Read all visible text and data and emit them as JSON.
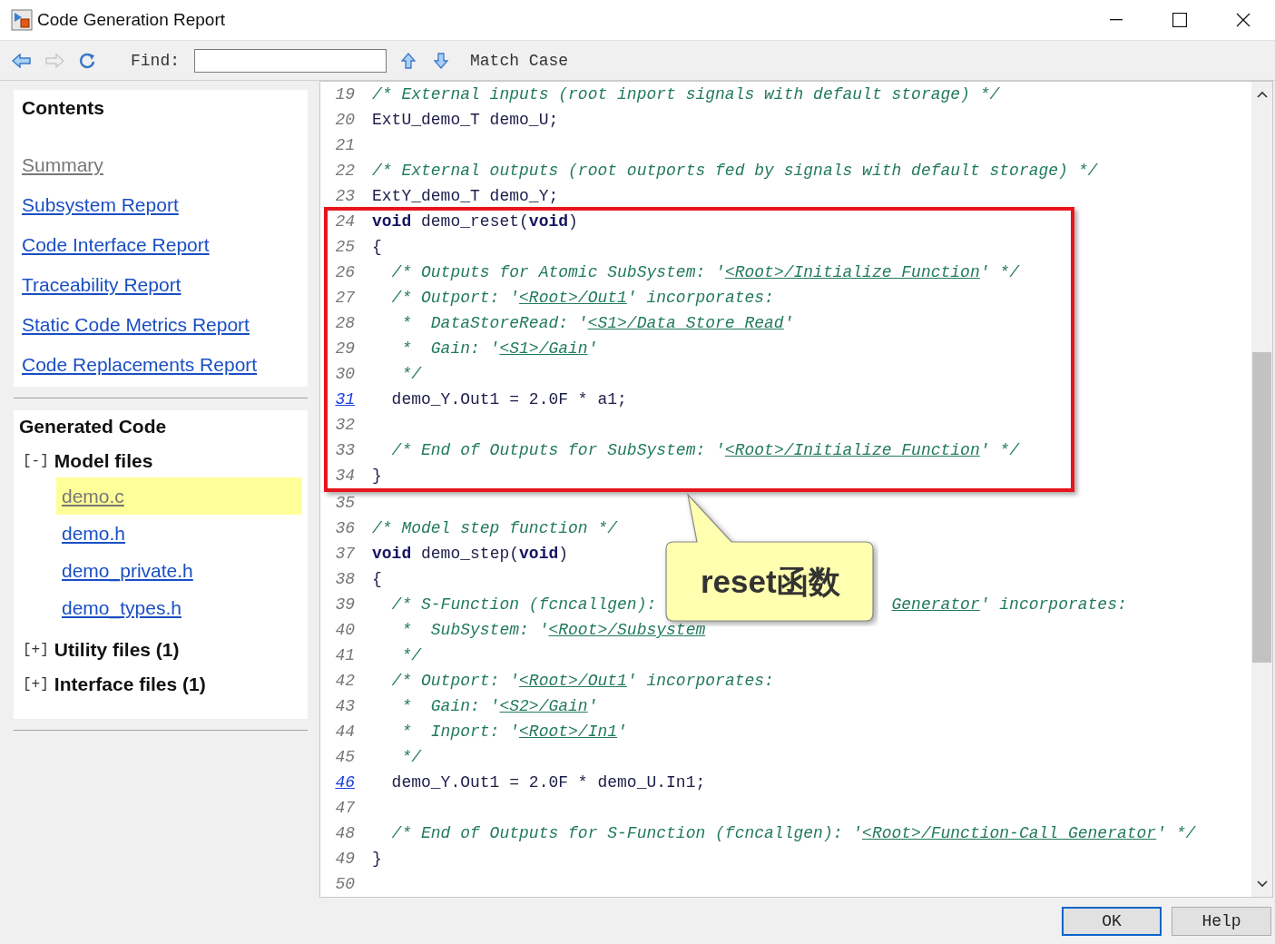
{
  "window": {
    "title": "Code Generation Report"
  },
  "toolbar": {
    "nav_buttons": [
      {
        "kind": "back",
        "disabled": false
      },
      {
        "kind": "forward",
        "disabled": true
      },
      {
        "kind": "refresh",
        "disabled": false
      }
    ],
    "find_label": "Find:",
    "match_case": "Match Case"
  },
  "sidebar": {
    "contents": {
      "title": "Contents",
      "items": [
        {
          "label": "Summary",
          "visited": true
        },
        {
          "label": "Subsystem Report",
          "visited": false
        },
        {
          "label": "Code Interface Report",
          "visited": false
        },
        {
          "label": "Traceability Report",
          "visited": false
        },
        {
          "label": "Static Code Metrics Report",
          "visited": false
        },
        {
          "label": "Code Replacements Report",
          "visited": false
        }
      ]
    },
    "generated_code": {
      "title": "Generated Code",
      "groups": [
        {
          "toggle": "[-]",
          "label": "Model files",
          "children": [
            {
              "label": "demo.c",
              "selected": true
            },
            {
              "label": "demo.h",
              "selected": false
            },
            {
              "label": "demo_private.h",
              "selected": false
            },
            {
              "label": "demo_types.h",
              "selected": false
            }
          ]
        },
        {
          "toggle": "[+]",
          "label": "Utility files (1)"
        },
        {
          "toggle": "[+]",
          "label": "Interface files (1)"
        }
      ]
    }
  },
  "code": {
    "sections": [
      {
        "highlighted": false,
        "lines": [
          {
            "number": "19",
            "number_link": false,
            "segments": [
              {
                "kind": "comment",
                "text": "/* External inputs (root inport signals with default storage) */"
              }
            ]
          },
          {
            "number": "20",
            "number_link": false,
            "segments": [
              {
                "kind": "code",
                "text": "ExtU_demo_T demo_U;"
              }
            ]
          },
          {
            "number": "21",
            "number_link": false
          },
          {
            "number": "22",
            "number_link": false,
            "segments": [
              {
                "kind": "comment",
                "text": "/* External outputs (root outports fed by signals with default storage) */"
              }
            ]
          },
          {
            "number": "23",
            "number_link": false,
            "segments": [
              {
                "kind": "code",
                "text": "ExtY_demo_T demo_Y;"
              }
            ]
          }
        ]
      },
      {
        "highlighted": true,
        "lines": [
          {
            "number": "24",
            "number_link": false,
            "segments": [
              {
                "kind": "keyword",
                "text": "void"
              },
              {
                "kind": "code",
                "text": " demo_reset("
              },
              {
                "kind": "keyword",
                "text": "void"
              },
              {
                "kind": "code",
                "text": ")"
              }
            ]
          },
          {
            "number": "25",
            "number_link": false,
            "segments": [
              {
                "kind": "code",
                "text": "{"
              }
            ]
          },
          {
            "number": "26",
            "number_link": false,
            "segments": [
              {
                "kind": "comment",
                "text": "  /* Outputs for Atomic SubSystem: '"
              },
              {
                "kind": "link",
                "text": "<Root>/Initialize Function"
              },
              {
                "kind": "comment",
                "text": "' */"
              }
            ]
          },
          {
            "number": "27",
            "number_link": false,
            "segments": [
              {
                "kind": "comment",
                "text": "  /* Outport: '"
              },
              {
                "kind": "link",
                "text": "<Root>/Out1"
              },
              {
                "kind": "comment",
                "text": "' incorporates:"
              }
            ]
          },
          {
            "number": "28",
            "number_link": false,
            "segments": [
              {
                "kind": "comment",
                "text": "   *  DataStoreRead: '"
              },
              {
                "kind": "link",
                "text": "<S1>/Data Store Read"
              },
              {
                "kind": "comment",
                "text": "'"
              }
            ]
          },
          {
            "number": "29",
            "number_link": false,
            "segments": [
              {
                "kind": "comment",
                "text": "   *  Gain: '"
              },
              {
                "kind": "link",
                "text": "<S1>/Gain"
              },
              {
                "kind": "comment",
                "text": "'"
              }
            ]
          },
          {
            "number": "30",
            "number_link": false,
            "segments": [
              {
                "kind": "comment",
                "text": "   */"
              }
            ]
          },
          {
            "number": "31",
            "number_link": true,
            "segments": [
              {
                "kind": "code",
                "text": "  demo_Y.Out1 = 2.0F * a1;"
              }
            ]
          },
          {
            "number": "32",
            "number_link": false
          },
          {
            "number": "33",
            "number_link": false,
            "segments": [
              {
                "kind": "comment",
                "text": "  /* End of Outputs for SubSystem: '"
              },
              {
                "kind": "link",
                "text": "<Root>/Initialize Function"
              },
              {
                "kind": "comment",
                "text": "' */"
              }
            ]
          },
          {
            "number": "34",
            "number_link": false,
            "segments": [
              {
                "kind": "code",
                "text": "}"
              }
            ]
          }
        ]
      },
      {
        "highlighted": false,
        "lines": [
          {
            "number": "35",
            "number_link": false
          },
          {
            "number": "36",
            "number_link": false,
            "segments": [
              {
                "kind": "comment",
                "text": "/* Model step function */"
              }
            ]
          },
          {
            "number": "37",
            "number_link": false,
            "segments": [
              {
                "kind": "keyword",
                "text": "void"
              },
              {
                "kind": "code",
                "text": " demo_step("
              },
              {
                "kind": "keyword",
                "text": "void"
              },
              {
                "kind": "code",
                "text": ")"
              }
            ]
          },
          {
            "number": "38",
            "number_link": false,
            "segments": [
              {
                "kind": "code",
                "text": "{"
              }
            ]
          },
          {
            "number": "39",
            "number_link": false,
            "segments": [
              {
                "kind": "comment",
                "text": "  /* S-Function (fcncallgen): "
              },
              {
                "kind": "covered"
              },
              {
                "kind": "link",
                "text": "Generator"
              },
              {
                "kind": "comment",
                "text": "' incorporates:"
              }
            ]
          },
          {
            "number": "40",
            "number_link": false,
            "segments": [
              {
                "kind": "comment",
                "text": "   *  SubSystem: '"
              },
              {
                "kind": "link",
                "text": "<Root>/Subsystem"
              }
            ]
          },
          {
            "number": "41",
            "number_link": false,
            "segments": [
              {
                "kind": "comment",
                "text": "   */"
              }
            ]
          },
          {
            "number": "42",
            "number_link": false,
            "segments": [
              {
                "kind": "comment",
                "text": "  /* Outport: '"
              },
              {
                "kind": "link",
                "text": "<Root>/Out1"
              },
              {
                "kind": "comment",
                "text": "' incorporates:"
              }
            ]
          },
          {
            "number": "43",
            "number_link": false,
            "segments": [
              {
                "kind": "comment",
                "text": "   *  Gain: '"
              },
              {
                "kind": "link",
                "text": "<S2>/Gain"
              },
              {
                "kind": "comment",
                "text": "'"
              }
            ]
          },
          {
            "number": "44",
            "number_link": false,
            "segments": [
              {
                "kind": "comment",
                "text": "   *  Inport: '"
              },
              {
                "kind": "link",
                "text": "<Root>/In1"
              },
              {
                "kind": "comment",
                "text": "'"
              }
            ]
          },
          {
            "number": "45",
            "number_link": false,
            "segments": [
              {
                "kind": "comment",
                "text": "   */"
              }
            ]
          },
          {
            "number": "46",
            "number_link": true,
            "segments": [
              {
                "kind": "code",
                "text": "  demo_Y.Out1 = 2.0F * demo_U.In1;"
              }
            ]
          },
          {
            "number": "47",
            "number_link": false
          },
          {
            "number": "48",
            "number_link": false,
            "segments": [
              {
                "kind": "comment",
                "text": "  /* End of Outputs for S-Function (fcncallgen): '"
              },
              {
                "kind": "link",
                "text": "<Root>/Function-Call Generator"
              },
              {
                "kind": "comment",
                "text": "' */"
              }
            ]
          },
          {
            "number": "49",
            "number_link": false,
            "segments": [
              {
                "kind": "code",
                "text": "}"
              }
            ]
          },
          {
            "number": "50",
            "number_link": false
          }
        ]
      }
    ]
  },
  "callout": {
    "text": "reset函数"
  },
  "buttons": [
    {
      "label": "OK",
      "focused": true
    },
    {
      "label": "Help",
      "focused": false
    }
  ]
}
